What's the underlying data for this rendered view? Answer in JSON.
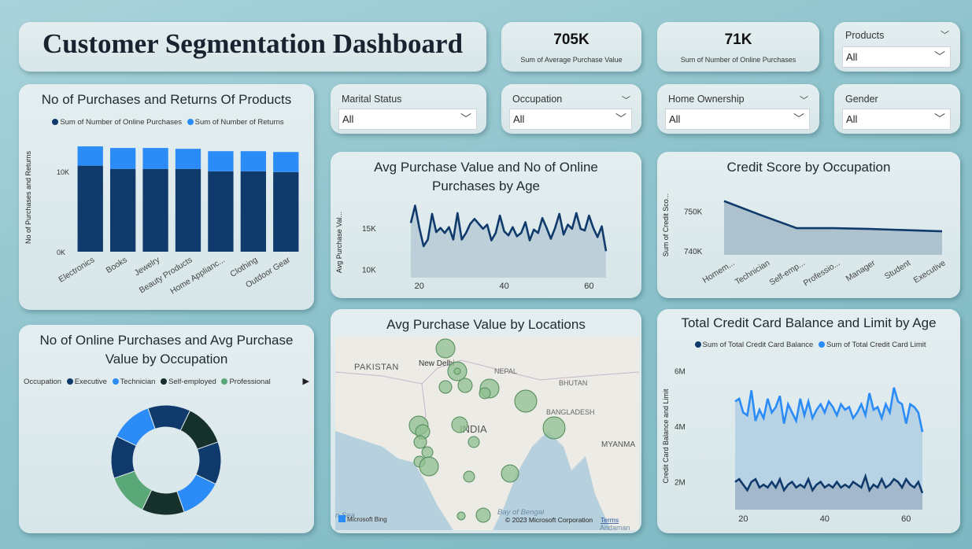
{
  "title": "Customer Segmentation Dashboard",
  "kpis": [
    {
      "value": "705K",
      "label": "Sum of Average Purchase Value"
    },
    {
      "value": "71K",
      "label": "Sum of Number of Online Purchases"
    }
  ],
  "slicers": {
    "products": {
      "label": "Products",
      "value": "All"
    },
    "marital": {
      "label": "Marital Status",
      "value": "All"
    },
    "occupation": {
      "label": "Occupation",
      "value": "All"
    },
    "home": {
      "label": "Home Ownership",
      "value": "All"
    },
    "gender": {
      "label": "Gender",
      "value": "All"
    }
  },
  "colors": {
    "dark_blue": "#0f3a6b",
    "blue": "#2b8cf7",
    "dark_green": "#16302c",
    "green": "#5aa777"
  },
  "icons": {
    "dropdown": "chevron-down-icon",
    "scroll": "play-icon"
  },
  "chart_data": [
    {
      "id": "purchases_returns",
      "type": "bar",
      "title": "No of Purchases and Returns Of Products",
      "ylabel": "No of Purchases and Returns",
      "ylim": [
        0,
        13500
      ],
      "yticks": [
        "0K",
        "10K"
      ],
      "categories": [
        "Electronics",
        "Books",
        "Jewelry",
        "Beauty Products",
        "Home Applianc...",
        "Clothing",
        "Outdoor Gear"
      ],
      "series": [
        {
          "name": "Sum of Number of Online Purchases",
          "values": [
            10700,
            10300,
            10300,
            10300,
            10000,
            10000,
            9900
          ]
        },
        {
          "name": "Sum of Number of Returns",
          "values": [
            2400,
            2600,
            2600,
            2500,
            2500,
            2500,
            2500
          ]
        }
      ],
      "stacked": true,
      "legend": "top"
    },
    {
      "id": "age_purchase",
      "type": "area",
      "title": "Avg Purchase Value and No of Online Purchases by Age",
      "ylabel": "Avg Purchase Val...",
      "yticks": [
        "10K",
        "15K"
      ],
      "xticks": [
        20,
        40,
        60
      ],
      "ylim": [
        9000,
        18500
      ],
      "x": [
        18,
        19,
        20,
        21,
        22,
        23,
        24,
        25,
        26,
        27,
        28,
        29,
        30,
        31,
        32,
        33,
        34,
        35,
        36,
        37,
        38,
        39,
        40,
        41,
        42,
        43,
        44,
        45,
        46,
        47,
        48,
        49,
        50,
        51,
        52,
        53,
        54,
        55,
        56,
        57,
        58,
        59,
        60,
        61,
        62,
        63,
        64
      ],
      "values": [
        15600,
        17700,
        15000,
        12800,
        13600,
        16700,
        14500,
        15000,
        14400,
        15100,
        13600,
        16800,
        13600,
        14400,
        15500,
        16100,
        15500,
        14900,
        15400,
        13500,
        14400,
        16500,
        14600,
        14100,
        15100,
        14000,
        14400,
        15700,
        13500,
        14800,
        14400,
        16200,
        15000,
        13700,
        15000,
        16700,
        14200,
        15400,
        14900,
        16800,
        14900,
        14700,
        16500,
        15000,
        13900,
        15200,
        12200
      ]
    },
    {
      "id": "credit_occupation",
      "type": "area",
      "title": "Credit Score by Occupation",
      "ylabel": "Sum of Credit Sco...",
      "yticks": [
        "740K",
        "750K"
      ],
      "ylim": [
        739000,
        754000
      ],
      "categories": [
        "Homem...",
        "Technician",
        "Self-emp...",
        "Professio...",
        "Manager",
        "Student",
        "Executive"
      ],
      "values": [
        752500,
        749000,
        745700,
        745700,
        745500,
        745200,
        744900
      ]
    },
    {
      "id": "occupation_donut",
      "type": "pie",
      "title": "No of Online Purchases and Avg Purchase Value by Occupation",
      "legend_title": "Occupation",
      "legend": [
        "Executive",
        "Technician",
        "Self-employed",
        "Professional"
      ],
      "slices": [
        {
          "name": "Self-employed",
          "value": 12.5,
          "color": "#16302c"
        },
        {
          "name": "Executive",
          "value": 12.5,
          "color": "#0f3a6b"
        },
        {
          "name": "Technician",
          "value": 12.5,
          "color": "#2b8cf7"
        },
        {
          "name": "Self-employed",
          "value": 12.5,
          "color": "#16302c"
        },
        {
          "name": "Professional",
          "value": 12.5,
          "color": "#5aa777"
        },
        {
          "name": "Executive",
          "value": 12.5,
          "color": "#0f3a6b"
        },
        {
          "name": "Technician",
          "value": 12.5,
          "color": "#2b8cf7"
        },
        {
          "name": "Self-employed",
          "value": 12.5,
          "color": "#0f3a6b"
        }
      ]
    },
    {
      "id": "credit_card_age",
      "type": "line",
      "title": "Total Credit Card Balance and Limit by Age",
      "ylabel": "Credit Card Balance and Limit",
      "yticks": [
        "2M",
        "4M",
        "6M"
      ],
      "xticks": [
        20,
        40,
        60
      ],
      "ylim": [
        1000000,
        6300000
      ],
      "x": [
        18,
        19,
        20,
        21,
        22,
        23,
        24,
        25,
        26,
        27,
        28,
        29,
        30,
        31,
        32,
        33,
        34,
        35,
        36,
        37,
        38,
        39,
        40,
        41,
        42,
        43,
        44,
        45,
        46,
        47,
        48,
        49,
        50,
        51,
        52,
        53,
        54,
        55,
        56,
        57,
        58,
        59,
        60,
        61,
        62,
        63,
        64
      ],
      "series": [
        {
          "name": "Sum of Total Credit Card Balance",
          "values": [
            2000000,
            2100000,
            1900000,
            1700000,
            2000000,
            2100000,
            1800000,
            1900000,
            1800000,
            2000000,
            1800000,
            2100000,
            1700000,
            1900000,
            2000000,
            1800000,
            1900000,
            1800000,
            2100000,
            1700000,
            1900000,
            2000000,
            1800000,
            1900000,
            1800000,
            2000000,
            1800000,
            1900000,
            1800000,
            2000000,
            1900000,
            1800000,
            2200000,
            1700000,
            1900000,
            1800000,
            2100000,
            1800000,
            1900000,
            2100000,
            2000000,
            1800000,
            2100000,
            1900000,
            1800000,
            2000000,
            1600000
          ]
        },
        {
          "name": "Sum of Total Credit Card Limit",
          "values": [
            4900000,
            5000000,
            4500000,
            4400000,
            5300000,
            4200000,
            4600000,
            4300000,
            5000000,
            4500000,
            4700000,
            5100000,
            4100000,
            4800000,
            4500000,
            4200000,
            5000000,
            4400000,
            4900000,
            4300000,
            4600000,
            4800000,
            4500000,
            4900000,
            4700000,
            4400000,
            4800000,
            4600000,
            4700000,
            4300000,
            4500000,
            4800000,
            4400000,
            5200000,
            4600000,
            4700000,
            4300000,
            4800000,
            4500000,
            5400000,
            4900000,
            4800000,
            4100000,
            4800000,
            4700000,
            4500000,
            3800000
          ]
        }
      ],
      "legend": "top"
    },
    {
      "id": "locations_map",
      "type": "scatter",
      "title": "Avg Purchase Value by Locations",
      "map_labels": [
        "PAKISTAN",
        "New Delhi",
        "NEPAL",
        "BHUTAN",
        "BANGLADESH",
        "INDIA",
        "MYANMA",
        "Bay of Bengal",
        "n Sea",
        "Andaman"
      ],
      "attribution": "© 2023 Microsoft Corporation",
      "terms": "Terms",
      "brand": "Microsoft Bing"
    }
  ]
}
